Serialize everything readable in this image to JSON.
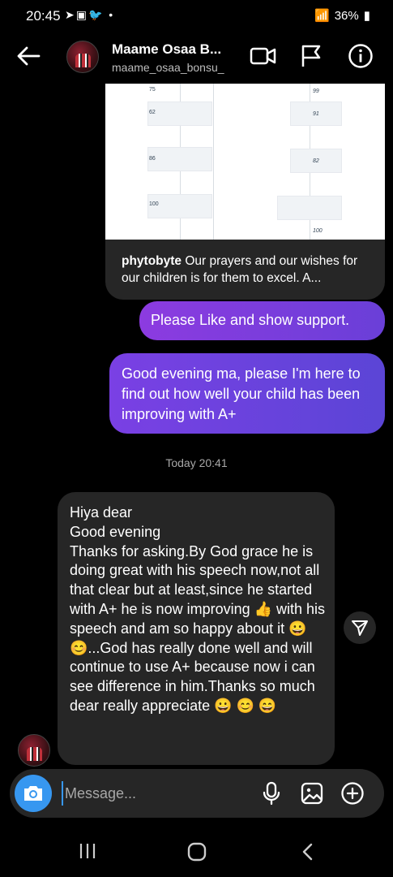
{
  "status_bar": {
    "time": "20:45",
    "battery": "36%"
  },
  "header": {
    "name": "Maame Osaa B...",
    "username": "maame_osaa_bonsu_"
  },
  "shared_post": {
    "table_left": [
      "75",
      "62",
      "86",
      "100"
    ],
    "table_right": [
      "99",
      "91",
      "82",
      "100"
    ],
    "caption_user": "phytobyte",
    "caption_text": "Our prayers and our wishes for our children is for them to excel. A..."
  },
  "messages": {
    "sent_1": "Please Like and show support.",
    "sent_2": "Good evening ma, please I'm here to find out how well your child has been improving with A+",
    "timestamp": "Today 20:41",
    "received_1": "Hiya dear\nGood evening\nThanks for asking.By God grace he is doing great with his speech now,not all that clear but at least,since he started with A+ he is now improving 👍 with his speech and am so happy about it 😀 😊...God has really done well and will continue to use A+ because now i can see difference in him.Thanks so much dear really appreciate 😀 😊 😄"
  },
  "composer": {
    "placeholder": "Message..."
  },
  "colors": {
    "accent_blue": "#3797f0",
    "bubble_purple": "#7a40e4",
    "bubble_dark": "#262626"
  }
}
